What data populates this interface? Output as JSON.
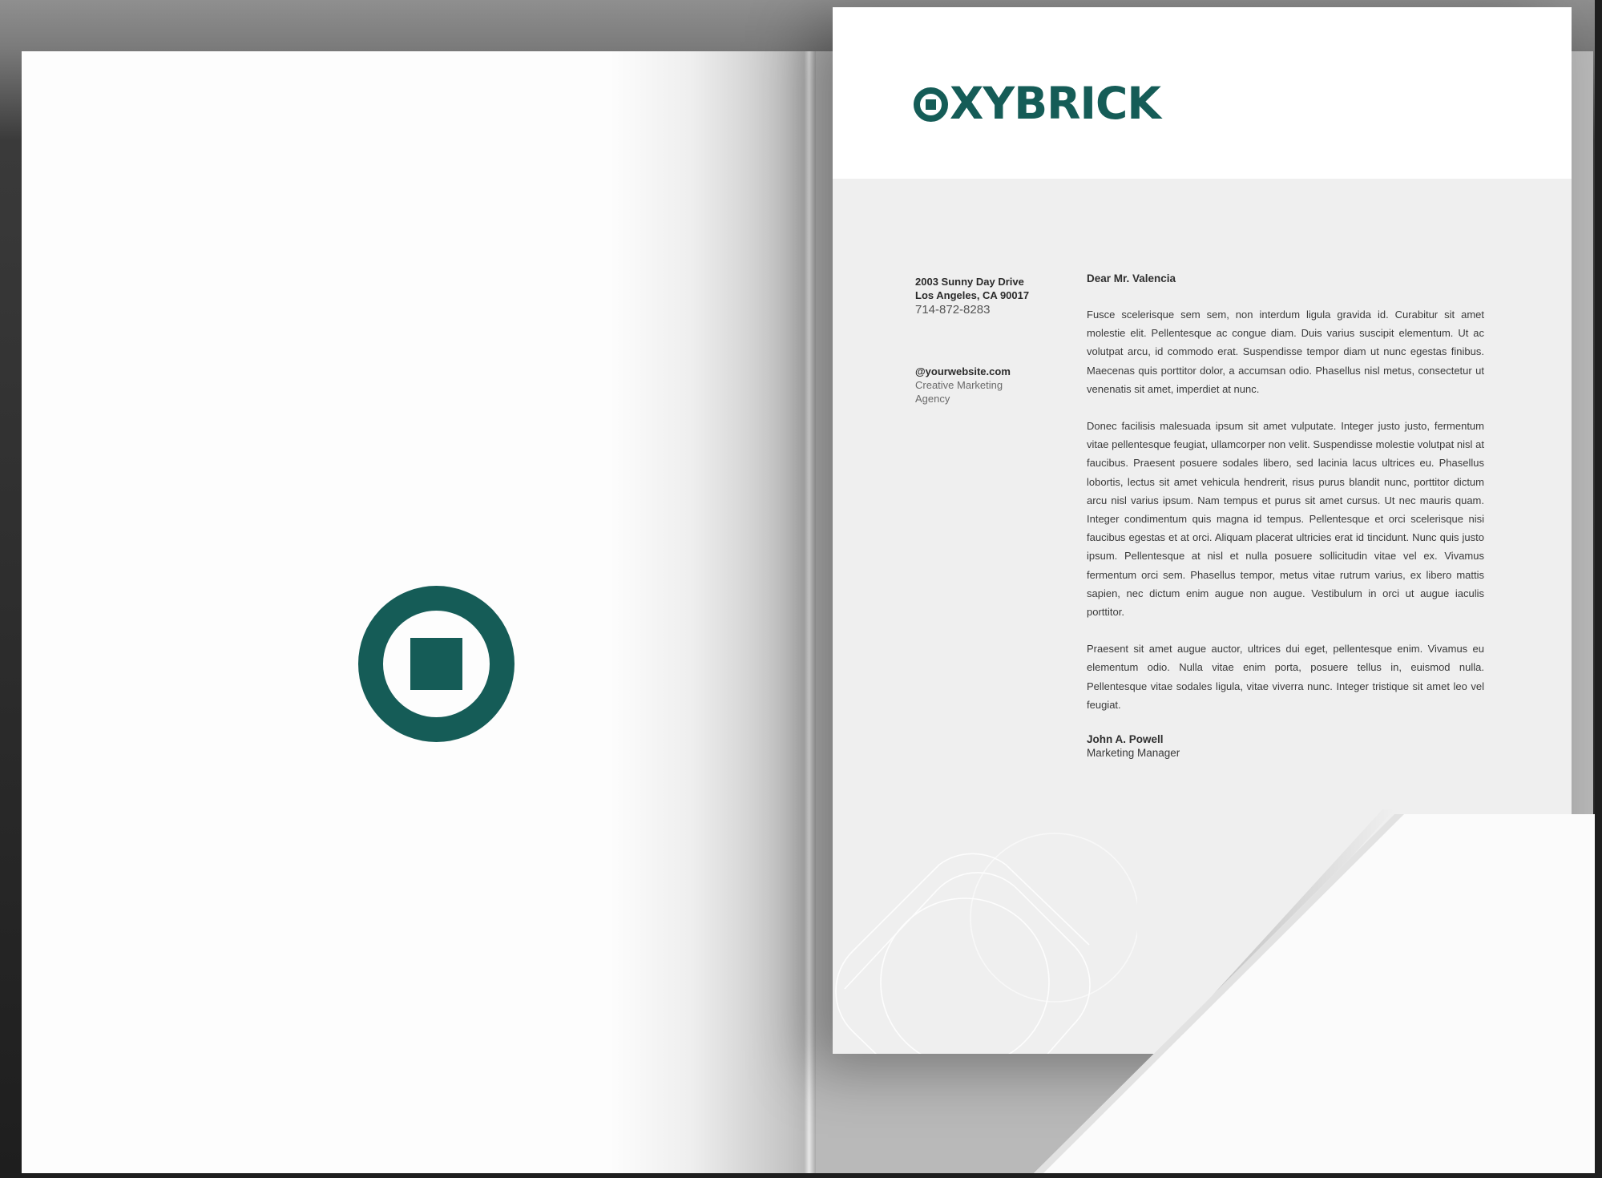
{
  "emblem": {
    "icon": "oxybrick-emblem-icon",
    "color": "#155c57"
  },
  "letterhead": {
    "logo_text": "XYBRICK",
    "logo_icon": "oxybrick-o-icon",
    "address_line1": "2003 Sunny Day Drive",
    "address_line2": "Los Angeles, CA 90017",
    "phone": "714-872-8283",
    "website": "@yourwebsite.com",
    "company_line1": "Creative Marketing",
    "company_line2": "Agency"
  },
  "letter": {
    "greeting": "Dear Mr. Valencia",
    "paragraphs": [
      "Fusce scelerisque sem sem, non interdum ligula gravida id. Curabitur sit amet molestie elit. Pellentesque ac congue diam. Duis varius suscipit elementum. Ut ac volutpat arcu, id commodo erat. Suspendisse tempor diam ut nunc egestas finibus. Maecenas quis porttitor dolor, a accumsan odio. Phasellus nisl metus, consectetur ut venenatis sit amet, imperdiet at nunc.",
      "Donec facilisis malesuada ipsum sit amet vulputate. Integer justo justo, fermentum vitae pellentesque feugiat, ullamcorper non velit. Suspendisse molestie volutpat nisl at faucibus. Praesent posuere sodales libero, sed lacinia lacus ultrices eu. Phasellus lobortis, lectus sit amet vehicula hendrerit, risus purus blandit nunc, porttitor dictum arcu nisl varius ipsum. Nam tempus et purus sit amet cursus. Ut nec mauris quam. Integer condimentum quis magna id tempus. Pellentesque et orci scelerisque nisi faucibus egestas et at orci. Aliquam placerat ultricies erat id tincidunt. Nunc quis justo ipsum. Pellentesque at nisl et nulla posuere sollicitudin vitae vel ex. Vivamus fermentum orci sem. Phasellus tempor, metus vitae rutrum varius, ex libero mattis sapien, nec dictum enim augue non augue. Vestibulum in orci ut augue iaculis porttitor.",
      "Praesent sit amet augue auctor, ultrices dui eget, pellentesque enim. Vivamus eu elementum odio. Nulla vitae enim porta, posuere tellus in, euismod nulla. Pellentesque vitae sodales ligula, vitae viverra nunc. Integer tristique sit amet leo vel feugiat."
    ],
    "signature_name": "John A. Powell",
    "signature_title": "Marketing Manager"
  }
}
